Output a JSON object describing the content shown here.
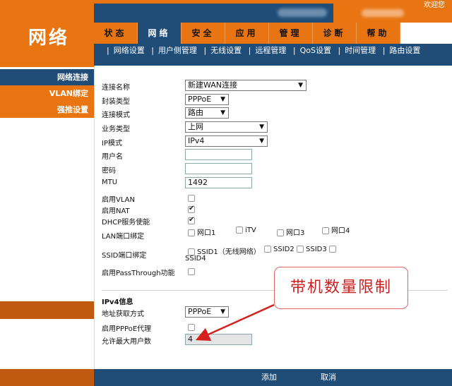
{
  "header": {
    "logo": "网络",
    "topbar_cut_text": "欢迎您"
  },
  "mainnav": [
    {
      "label": "状态",
      "active": false
    },
    {
      "label": "网络",
      "active": true
    },
    {
      "label": "安全",
      "active": false
    },
    {
      "label": "应用",
      "active": false
    },
    {
      "label": "管理",
      "active": false
    },
    {
      "label": "诊断",
      "active": false
    },
    {
      "label": "帮助",
      "active": false
    }
  ],
  "subnav": [
    {
      "label": "网络设置"
    },
    {
      "label": "用户侧管理"
    },
    {
      "label": "无线设置"
    },
    {
      "label": "远程管理"
    },
    {
      "label": "QoS设置"
    },
    {
      "label": "时间管理"
    },
    {
      "label": "路由设置"
    }
  ],
  "sidebar": [
    {
      "label": "网络连接",
      "active": true
    },
    {
      "label": "VLAN绑定",
      "active": false
    },
    {
      "label": "强推设置",
      "active": false
    }
  ],
  "form": {
    "conn_name_label": "连接名称",
    "conn_name_value": "新建WAN连接",
    "encap_label": "封装类型",
    "encap_value": "PPPoE",
    "conn_mode_label": "连接模式",
    "conn_mode_value": "路由",
    "service_label": "业务类型",
    "service_value": "上网",
    "ip_mode_label": "IP模式",
    "ip_mode_value": "IPv4",
    "username_label": "用户名",
    "username_value": "",
    "password_label": "密码",
    "password_value": "",
    "mtu_label": "MTU",
    "mtu_value": "1492",
    "vlan_label": "启用VLAN",
    "vlan_checked": false,
    "nat_label": "启用NAT",
    "nat_checked": true,
    "dhcp_label": "DHCP服务使能",
    "dhcp_checked": true,
    "lan_bind_label": "LAN端口绑定",
    "lan_ports": [
      "网口1",
      "iTV",
      "网口3",
      "网口4"
    ],
    "ssid_bind_label": "SSID端口绑定",
    "ssids": [
      "SSID1（无线网络）",
      "SSID2",
      "SSID3",
      "SSID4"
    ],
    "passthrough_label": "启用PassThrough功能",
    "passthrough_checked": false
  },
  "ipv4": {
    "title": "IPv4信息",
    "addr_label": "地址获取方式",
    "addr_value": "PPPoE",
    "pppoe_proxy_label": "启用PPPoE代理",
    "pppoe_proxy_checked": false,
    "max_users_label": "允许最大用户数",
    "max_users_value": "4"
  },
  "callout": {
    "text": "带机数量限制"
  },
  "footer": {
    "add_label": "添加",
    "cancel_label": "取消"
  },
  "colors": {
    "orange": "#e87512",
    "dark_orange": "#c05a0e",
    "navy": "#1f4d78",
    "callout_red": "#cc1f1f"
  }
}
